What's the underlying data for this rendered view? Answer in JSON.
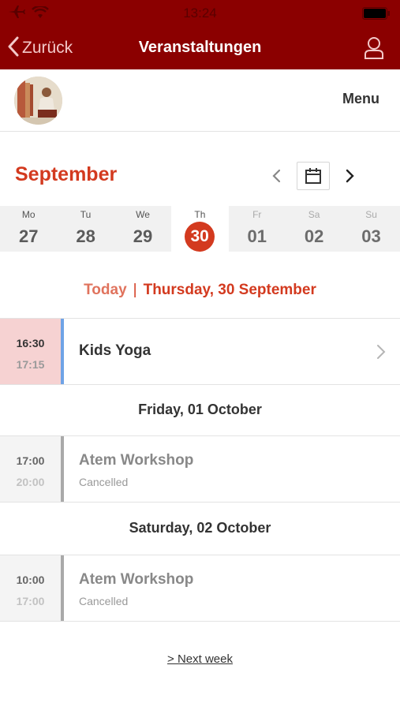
{
  "status_bar": {
    "time": "13:24"
  },
  "nav": {
    "back_label": "Zurück",
    "title": "Veranstaltungen"
  },
  "header": {
    "menu_label": "Menu"
  },
  "calendar": {
    "month": "September",
    "week": [
      {
        "name": "Mo",
        "num": "27"
      },
      {
        "name": "Tu",
        "num": "28"
      },
      {
        "name": "We",
        "num": "29"
      },
      {
        "name": "Th",
        "num": "30"
      },
      {
        "name": "Fr",
        "num": "01"
      },
      {
        "name": "Sa",
        "num": "02"
      },
      {
        "name": "Su",
        "num": "03"
      }
    ]
  },
  "today_heading": {
    "today": "Today",
    "separator": "|",
    "date": "Thursday, 30 September"
  },
  "events": [
    {
      "start": "16:30",
      "end": "17:15",
      "title": "Kids Yoga",
      "status": ""
    },
    {
      "start": "17:00",
      "end": "20:00",
      "title": "Atem Workshop",
      "status": "Cancelled"
    },
    {
      "start": "10:00",
      "end": "17:00",
      "title": "Atem Workshop",
      "status": "Cancelled"
    }
  ],
  "day_headings": [
    "Friday, 01 October",
    "Saturday, 02 October"
  ],
  "footer": {
    "next_week_label": "> Next week"
  },
  "colors": {
    "nav_bg": "#8b0000",
    "accent": "#d33a1f",
    "highlight_stripe": "#6fa3e6"
  }
}
